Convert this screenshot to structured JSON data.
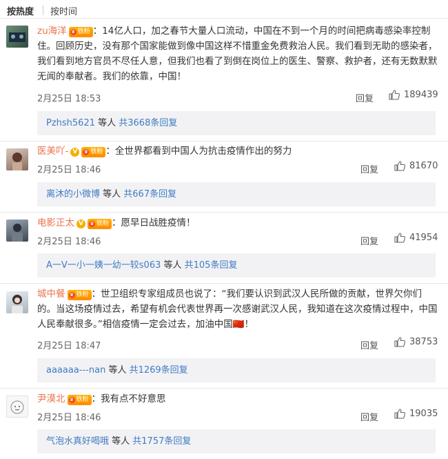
{
  "sort": {
    "hot": "按热度",
    "time": "按时间"
  },
  "comments": [
    {
      "user": "zu海洋",
      "vip": false,
      "fan_badge": "铁粉",
      "text_lines": [
        "：14亿人口，加之春节大量人口流动，中国在不到一个月的时间把病毒感染率控制",
        "住。回顾历史，没有那个国家能做到像中国这样不惜重金免费救治人民。我们看到无助的感染者，",
        "我们看到地方官员不尽任人意，但我们也看了到倒在岗位上的医生、警察、救护者，还有无数默默",
        "无闻的奉献者。我们的依靠，中国！"
      ],
      "time": "2月25日 18:53",
      "reply_label": "回复",
      "likes": "189439",
      "reply_user": "Pzhsh5621",
      "reply_mid": " 等人 ",
      "reply_count": "共3668条回复"
    },
    {
      "user": "医美吖-",
      "vip": true,
      "fan_badge": "铁粉",
      "text_lines": [
        "：全世界都看到中国人为抗击疫情作出的努力"
      ],
      "time": "2月25日 18:46",
      "reply_label": "回复",
      "likes": "81670",
      "reply_user": "离沐的小微博",
      "reply_mid": " 等人 ",
      "reply_count": "共667条回复"
    },
    {
      "user": "电影正太",
      "vip": true,
      "fan_badge": "铁粉",
      "text_lines": [
        "：愿早日战胜疫情！"
      ],
      "time": "2月25日 18:46",
      "reply_label": "回复",
      "likes": "41954",
      "reply_user": "A一V一小一姨一幼一较s063",
      "reply_mid": " 等人 ",
      "reply_count": "共105条回复"
    },
    {
      "user": "城中餐",
      "vip": false,
      "fan_badge": "铁粉",
      "text_lines": [
        "：世卫组织专家组成员也说了：“我们要认识到武汉人民所做的贡献，世界欠你们",
        "的。当这场疫情过去，希望有机会代表世界再一次感谢武汉人民，我知道在这次疫情过程中，中国",
        "人民奉献很多。”相信疫情一定会过去，加油中国🇨🇳！"
      ],
      "time": "2月25日 18:47",
      "reply_label": "回复",
      "likes": "38753",
      "reply_user": "aaaaaa---nan",
      "reply_mid": " 等人 ",
      "reply_count": "共1269条回复"
    },
    {
      "user": "尹漠北",
      "vip": false,
      "fan_badge": "铁粉",
      "text_lines": [
        "：我有点不好意思"
      ],
      "time": "2月25日 18:46",
      "reply_label": "回复",
      "likes": "19035",
      "reply_user": "气泡水真好喝哦",
      "reply_mid": " 等人 ",
      "reply_count": "共1757条回复"
    }
  ]
}
